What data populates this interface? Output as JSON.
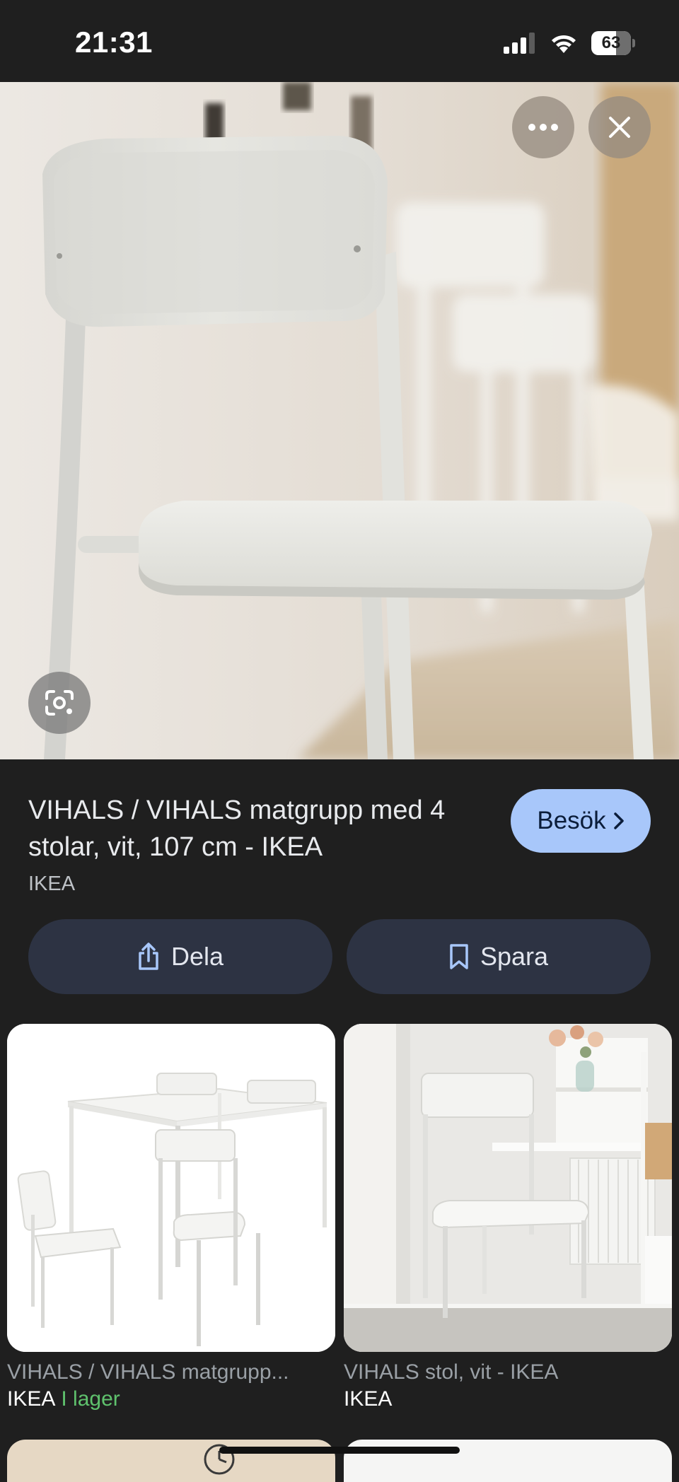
{
  "status_bar": {
    "time": "21:31",
    "battery_level": "63",
    "battery_fraction": 0.63,
    "icons": [
      "cellular-signal-icon",
      "wifi-icon",
      "battery-icon"
    ]
  },
  "viewer": {
    "actions": [
      "more-options-icon",
      "close-icon",
      "lens-search-icon"
    ]
  },
  "result": {
    "title": "VIHALS / VIHALS matgrupp med 4 stolar, vit, 107 cm - IKEA",
    "source": "IKEA",
    "visit_label": "Besök",
    "share_label": "Dela",
    "save_label": "Spara"
  },
  "related": [
    {
      "title": "VIHALS / VIHALS matgrupp...",
      "source": "IKEA",
      "stock": "I lager"
    },
    {
      "title": "VIHALS stol, vit - IKEA",
      "source": "IKEA",
      "stock": ""
    }
  ],
  "colors": {
    "background": "#1f1f1f",
    "visit_button": "#a8c7fa",
    "pill_button": "#2d3343",
    "in_stock": "#5fc26d"
  }
}
